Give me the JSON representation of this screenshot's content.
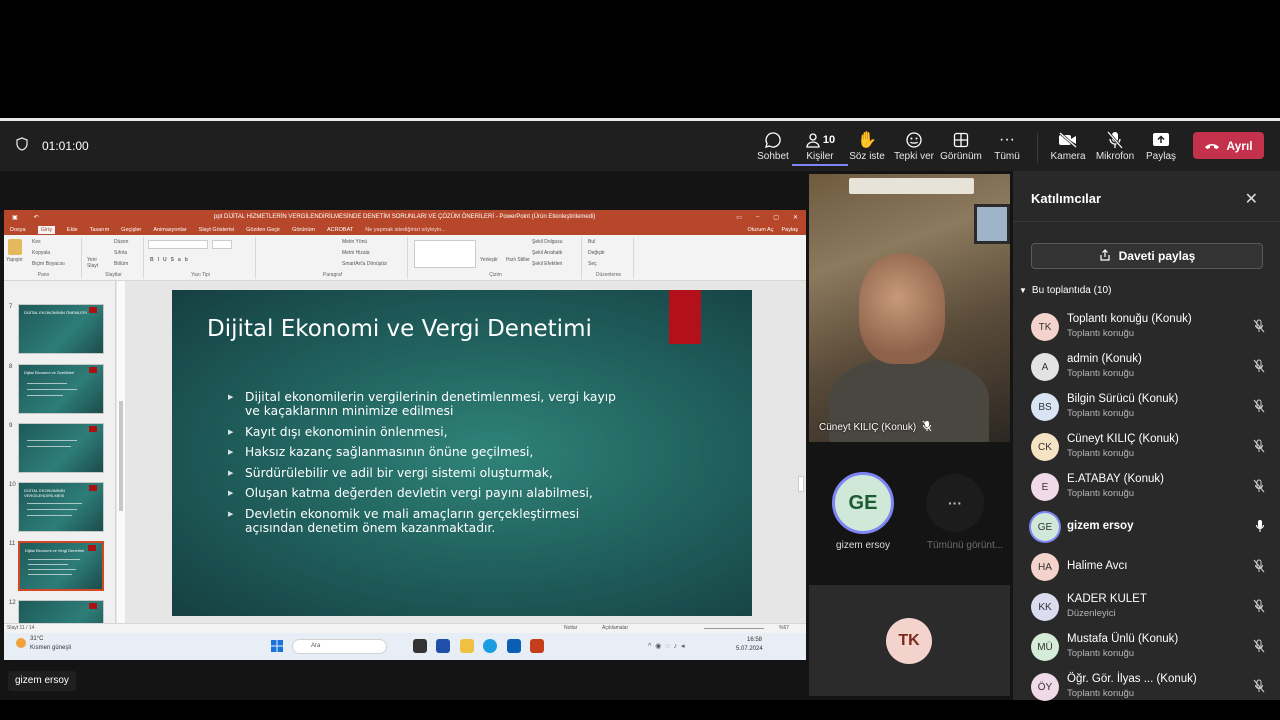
{
  "meeting": {
    "timer": "01:01:00",
    "toolbar": [
      {
        "key": "chat",
        "label": "Sohbet",
        "icon": "chat-icon"
      },
      {
        "key": "people",
        "label": "Kişiler",
        "icon": "people-icon",
        "count": "10"
      },
      {
        "key": "raise",
        "label": "Söz iste",
        "icon": "raise-hand-icon"
      },
      {
        "key": "react",
        "label": "Tepki ver",
        "icon": "reaction-icon"
      },
      {
        "key": "view",
        "label": "Görünüm",
        "icon": "grid-view-icon"
      },
      {
        "key": "more",
        "label": "Tümü",
        "icon": "more-icon"
      },
      {
        "key": "camera",
        "label": "Kamera",
        "icon": "camera-off-icon"
      },
      {
        "key": "mic",
        "label": "Mikrofon",
        "icon": "mic-off-icon"
      },
      {
        "key": "share",
        "label": "Paylaş",
        "icon": "share-screen-icon"
      }
    ],
    "leave_label": "Ayrıl"
  },
  "ppt": {
    "window_title": "ppt DİJİTAL HİZMETLERİN VERGİLENDİRİLMESİNDE DENETİM SORUNLARI VE ÇÖZÜM ÖNERİLERİ - PowerPoint (Ürün Etkinleştirilemedi)",
    "tabs": [
      "Dosya",
      "Giriş",
      "Ekle",
      "Tasarım",
      "Geçişler",
      "Animasyonlar",
      "Slayt Gösterisi",
      "Gözden Geçir",
      "Görünüm",
      "ACROBAT"
    ],
    "tell_me": "Ne yapmak istediğinizi söyleyin...",
    "signin": "Oturum Aç",
    "share": "Paylaş",
    "ribbon_groups": [
      "Pano",
      "Slaytlar",
      "Yazı Tipi",
      "Paragraf",
      "Çizim",
      "Düzenleme"
    ],
    "ribbon": {
      "paste": "Yapıştır",
      "cut": "Kes",
      "copy": "Kopyala",
      "format_painter": "Biçim Boyacısı",
      "new_slide": "Yeni Slayt",
      "layout": "Düzen",
      "reset": "Sıfırla",
      "section": "Bölüm",
      "text_dir": "Metin Yönü",
      "align_text": "Metni Hizala",
      "smartart": "SmartArt'a Dönüştür",
      "arrange": "Yerleştir",
      "quick_styles": "Hızlı Stiller",
      "shape_fill": "Şekil Dolgusu",
      "shape_outline": "Şekil Anahattı",
      "shape_effects": "Şekil Efektleri",
      "find": "Bul",
      "replace": "Değiştir",
      "select": "Seç"
    },
    "thumbnails": [
      {
        "num": "7",
        "title": "DİJİTAL EKONOMİNİN ÖNEMLERİ"
      },
      {
        "num": "8",
        "title": "Dijital Ekonomi ve Özellikleri"
      },
      {
        "num": "9",
        "title": ""
      },
      {
        "num": "10",
        "title": "DİJİTAL EKONOMİNİN VERGİLENDİRİLMESİ"
      },
      {
        "num": "11",
        "title": "Dijital Ekonomi ve Vergi Denetimi"
      },
      {
        "num": "12",
        "title": ""
      }
    ],
    "slide": {
      "title": "Dijital Ekonomi ve Vergi Denetimi",
      "bullets": [
        "Dijital ekonomilerin vergilerinin denetimlenmesi, vergi kayıp ve kaçaklarının minimize edilmesi",
        "Kayıt dışı ekonominin önlenmesi,",
        "Haksız kazanç sağlanmasının önüne geçilmesi,",
        "Sürdürülebilir ve adil bir vergi sistemi oluşturmak,",
        "Oluşan katma değerden devletin vergi payını alabilmesi,",
        "Devletin ekonomik ve mali amaçların gerçekleştirmesi açısından denetim önem kazanmaktadır."
      ]
    },
    "status": {
      "slide_count": "Slayt 11 / 14",
      "notes": "Notlar",
      "comments": "Açıklamalar",
      "zoom": "%67"
    },
    "taskbar": {
      "weather_temp": "31°C",
      "weather_desc": "Kısmen güneşli",
      "search": "Ara",
      "time": "16:58",
      "date": "5.07.2024"
    }
  },
  "video": {
    "main_name": "Cüneyt KILIÇ (Konuk)",
    "ge": {
      "initials": "GE",
      "name": "gizem ersoy",
      "color": "#cfe8d8"
    },
    "more_label": "Tümünü görünt...",
    "tk": {
      "initials": "TK",
      "color": "#f3d3cc"
    }
  },
  "participants": {
    "title": "Katılımcılar",
    "share_invite": "Daveti paylaş",
    "section": "Bu toplantıda (10)",
    "list": [
      {
        "initials": "TK",
        "name": "Toplantı konuğu (Konuk)",
        "role": "Toplantı konuğu",
        "color": "#f3d3cc",
        "mic": "off"
      },
      {
        "initials": "A",
        "name": "admin (Konuk)",
        "role": "Toplantı konuğu",
        "color": "#e3e3e3",
        "mic": "off"
      },
      {
        "initials": "BS",
        "name": "Bilgin Sürücü (Konuk)",
        "role": "Toplantı konuğu",
        "color": "#d9e4f5",
        "mic": "off"
      },
      {
        "initials": "CK",
        "name": "Cüneyt KILIÇ (Konuk)",
        "role": "Toplantı konuğu",
        "color": "#f5e3c4",
        "mic": "off"
      },
      {
        "initials": "E",
        "name": "E.ATABAY (Konuk)",
        "role": "Toplantı konuğu",
        "color": "#f0d9e8",
        "mic": "off"
      },
      {
        "initials": "GE",
        "name": "gizem ersoy",
        "role": "",
        "color": "#cfe8d8",
        "mic": "on"
      },
      {
        "initials": "HA",
        "name": "Halime Avcı",
        "role": "",
        "color": "#f3d3cc",
        "mic": "off"
      },
      {
        "initials": "KK",
        "name": "KADER KULET",
        "role": "Düzenleyici",
        "color": "#dcdcf0",
        "mic": "off"
      },
      {
        "initials": "MÜ",
        "name": "Mustafa Ünlü (Konuk)",
        "role": "Toplantı konuğu",
        "color": "#d5ecd8",
        "mic": "off"
      },
      {
        "initials": "ÖY",
        "name": "Öğr. Gör. İlyas ...  (Konuk)",
        "role": "Toplantı konuğu",
        "color": "#f0d9e8",
        "mic": "off"
      }
    ]
  },
  "self_label": "gizem ersoy"
}
